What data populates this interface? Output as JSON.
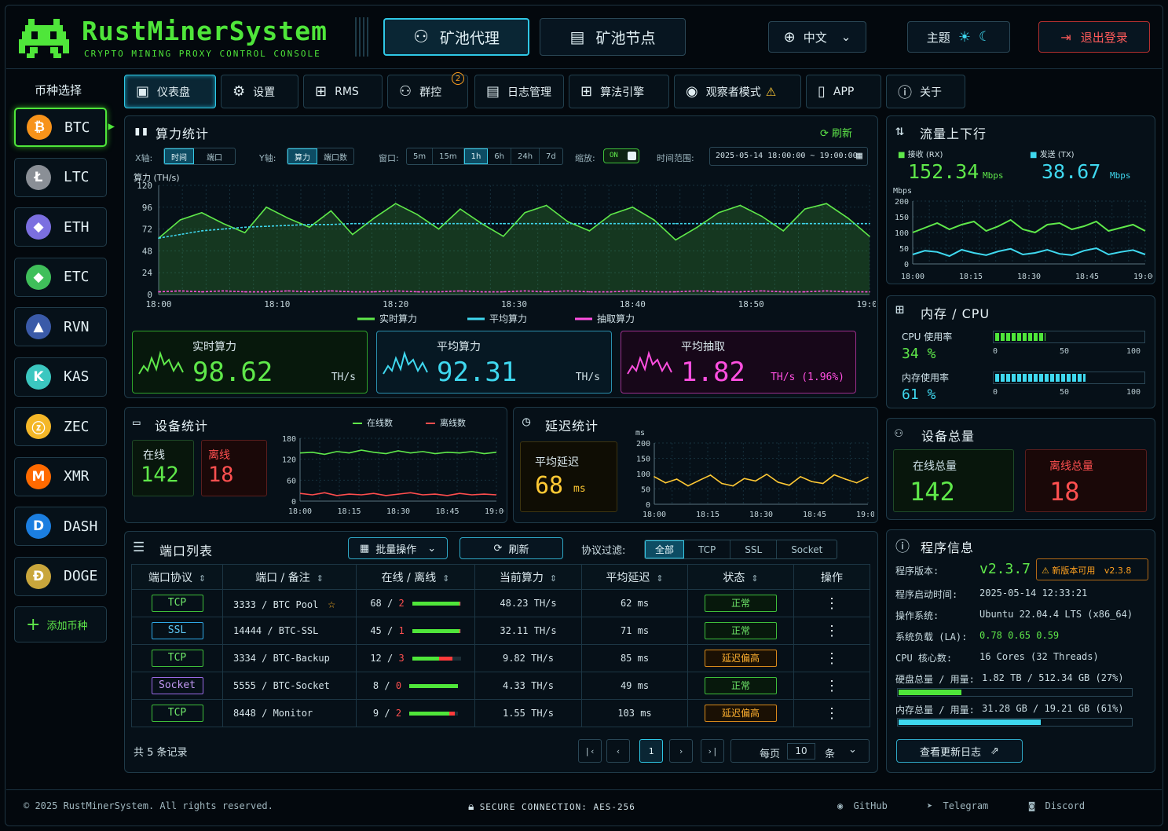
{
  "header": {
    "logo": "RustMinerSystem",
    "subtitle": "CRYPTO MINING PROXY CONTROL CONSOLE",
    "nav": [
      "矿池代理",
      "矿池节点"
    ],
    "lang": "中文",
    "theme": "主题",
    "logout": "退出登录"
  },
  "sidebar": {
    "title": "币种选择",
    "coins": [
      {
        "name": "BTC",
        "glyph": "₿",
        "color": "#f7931a"
      },
      {
        "name": "LTC",
        "glyph": "Ł",
        "color": "#8a8f96"
      },
      {
        "name": "ETH",
        "glyph": "◆",
        "color": "#7b6fe0"
      },
      {
        "name": "ETC",
        "glyph": "◆",
        "color": "#3fbf5a"
      },
      {
        "name": "RVN",
        "glyph": "▲",
        "color": "#3a5aa8"
      },
      {
        "name": "KAS",
        "glyph": "K",
        "color": "#3bc7c0"
      },
      {
        "name": "ZEC",
        "glyph": "ⓩ",
        "color": "#f4b728"
      },
      {
        "name": "XMR",
        "glyph": "M",
        "color": "#ff6a00"
      },
      {
        "name": "DASH",
        "glyph": "D",
        "color": "#1b7ee0"
      },
      {
        "name": "DOGE",
        "glyph": "Ð",
        "color": "#c9a63c"
      }
    ],
    "add": "添加币种"
  },
  "tabs": [
    {
      "label": "仪表盘"
    },
    {
      "label": "设置"
    },
    {
      "label": "RMS"
    },
    {
      "label": "群控",
      "badge": "2"
    },
    {
      "label": "日志管理"
    },
    {
      "label": "算法引擎"
    },
    {
      "label": "观察者模式"
    },
    {
      "label": "APP"
    },
    {
      "label": "关于"
    }
  ],
  "hashrate": {
    "title": "算力统计",
    "refresh": "刷新",
    "xaxis_label": "X轴:",
    "xaxis_opts": [
      "时间",
      "端口"
    ],
    "yaxis_label": "Y轴:",
    "yaxis_opts": [
      "算力",
      "端口数"
    ],
    "window_label": "窗口:",
    "windows": [
      "5m",
      "15m",
      "1h",
      "6h",
      "24h",
      "7d"
    ],
    "zoom_label": "缩放:",
    "zoom_state": "ON",
    "range_label": "时间范围:",
    "range_value": "2025-05-14 18:00:00 ~ 19:00:00",
    "unit_label": "算力 (TH/s)",
    "kpis": [
      {
        "title": "实时算力",
        "value": "98.62",
        "unit": "TH/s"
      },
      {
        "title": "平均算力",
        "value": "92.31",
        "unit": "TH/s"
      },
      {
        "title": "平均抽取",
        "value": "1.82",
        "unit": "TH/s (1.96%)"
      }
    ]
  },
  "chart_data": [
    {
      "type": "line",
      "title": "算力统计",
      "ylabel": "算力 (TH/s)",
      "ylim": [
        0,
        120
      ],
      "yticks": [
        0,
        24,
        48,
        72,
        96,
        120
      ],
      "x": [
        "18:00",
        "18:10",
        "18:20",
        "18:30",
        "18:40",
        "18:50",
        "19:00"
      ],
      "series": [
        {
          "name": "实时算力",
          "color": "#5fe84a",
          "values": [
            62,
            82,
            90,
            78,
            68,
            96,
            84,
            74,
            92,
            66,
            84,
            100,
            88,
            72,
            94,
            78,
            64,
            90,
            98,
            80,
            70,
            88,
            96,
            82,
            60,
            74,
            90,
            98,
            86,
            70,
            94,
            100,
            84,
            64
          ]
        },
        {
          "name": "平均算力",
          "color": "#3fd8ef",
          "values": [
            62,
            66,
            70,
            72,
            74,
            75,
            76,
            77,
            77,
            78,
            78,
            78,
            78,
            78,
            78,
            78,
            78,
            78,
            78,
            78,
            78,
            78,
            78,
            78,
            78,
            78,
            78,
            78,
            78,
            78,
            78,
            78,
            78,
            78
          ]
        },
        {
          "name": "抽取算力",
          "color": "#ff4fe0",
          "values": [
            3,
            4,
            3,
            4,
            3,
            3,
            4,
            3,
            4,
            3,
            3,
            4,
            3,
            3,
            4,
            3,
            3,
            4,
            3,
            4,
            3,
            3,
            4,
            3,
            3,
            4,
            3,
            3,
            4,
            3,
            3,
            4,
            3,
            3
          ]
        }
      ]
    },
    {
      "type": "line",
      "title": "流量上下行",
      "ylabel": "Mbps",
      "ylim": [
        0,
        200
      ],
      "yticks": [
        0,
        50,
        100,
        150,
        200
      ],
      "x": [
        "18:00",
        "18:15",
        "18:30",
        "18:45",
        "19:00"
      ],
      "series": [
        {
          "name": "接收 (RX)",
          "color": "#5fe84a",
          "values": [
            100,
            115,
            130,
            110,
            125,
            135,
            105,
            120,
            140,
            110,
            100,
            125,
            130,
            110,
            120,
            135,
            105,
            115,
            125,
            105
          ]
        },
        {
          "name": "发送 (TX)",
          "color": "#3fd8ef",
          "values": [
            30,
            42,
            38,
            25,
            45,
            35,
            28,
            40,
            48,
            30,
            35,
            45,
            32,
            28,
            42,
            50,
            30,
            38,
            44,
            30
          ]
        }
      ]
    },
    {
      "type": "line",
      "title": "设备统计",
      "ylim": [
        0,
        180
      ],
      "yticks": [
        0,
        60,
        120,
        180
      ],
      "x": [
        "18:00",
        "18:15",
        "18:30",
        "18:45",
        "19:00"
      ],
      "series": [
        {
          "name": "在线数",
          "color": "#5fe84a",
          "values": [
            138,
            140,
            134,
            142,
            138,
            146,
            140,
            136,
            144,
            138,
            142,
            136,
            140,
            138,
            142,
            136,
            140
          ]
        },
        {
          "name": "离线数",
          "color": "#ff4d4d",
          "values": [
            22,
            18,
            24,
            16,
            20,
            18,
            22,
            16,
            20,
            24,
            18,
            20,
            16,
            22,
            18,
            20,
            18
          ]
        }
      ]
    },
    {
      "type": "line",
      "title": "延迟统计",
      "ylabel": "ms",
      "ylim": [
        0,
        200
      ],
      "yticks": [
        0,
        50,
        100,
        150,
        200
      ],
      "x": [
        "18:00",
        "18:15",
        "18:30",
        "18:45",
        "19:00"
      ],
      "series": [
        {
          "name": "延迟",
          "color": "#ffc934",
          "values": [
            90,
            70,
            82,
            60,
            78,
            95,
            68,
            60,
            84,
            76,
            98,
            72,
            62,
            90,
            74,
            68,
            96,
            82,
            70,
            88
          ]
        }
      ]
    }
  ],
  "traffic": {
    "title": "流量上下行",
    "rx_label": "接收 (RX)",
    "rx_value": "152.34",
    "tx_label": "发送 (TX)",
    "tx_value": "38.67",
    "unit": "Mbps"
  },
  "resources": {
    "title": "内存 / CPU",
    "cpu_label": "CPU 使用率",
    "cpu_value": "34 %",
    "cpu_level": 34,
    "mem_label": "内存使用率",
    "mem_value": "61 %",
    "mem_level": 61,
    "scale": [
      "0",
      "50",
      "100"
    ]
  },
  "devices_total": {
    "title": "设备总量",
    "online_label": "在线总量",
    "online": "142",
    "offline_label": "离线总量",
    "offline": "18"
  },
  "devices": {
    "title": "设备统计",
    "online_label": "在线",
    "online": "142",
    "offline_label": "离线",
    "offline": "18",
    "legend_online": "在线数",
    "legend_offline": "离线数"
  },
  "latency": {
    "title": "延迟统计",
    "avg_label": "平均延迟",
    "avg_value": "68",
    "unit": "ms"
  },
  "ports": {
    "title": "端口列表",
    "batch": "批量操作",
    "refresh": "刷新",
    "filter_label": "协议过滤:",
    "filters": [
      "全部",
      "TCP",
      "SSL",
      "Socket"
    ],
    "headers": [
      "端口协议",
      "端口 / 备注",
      "在线 / 离线",
      "当前算力",
      "平均延迟",
      "状态",
      "操作"
    ],
    "rows": [
      {
        "proto": "TCP",
        "port": "3333 / BTC Pool",
        "star": true,
        "online": "68",
        "offline": "2",
        "online_frac": 0.97,
        "hash": "48.23 TH/s",
        "lat": "62 ms",
        "status": "正常"
      },
      {
        "proto": "SSL",
        "port": "14444 / BTC-SSL",
        "star": false,
        "online": "45",
        "offline": "1",
        "online_frac": 0.98,
        "hash": "32.11 TH/s",
        "lat": "71 ms",
        "status": "正常"
      },
      {
        "proto": "TCP",
        "port": "3334 / BTC-Backup",
        "star": false,
        "online": "12",
        "offline": "3",
        "online_frac": 0.55,
        "hash": "9.82 TH/s",
        "lat": "85 ms",
        "status": "延迟偏高"
      },
      {
        "proto": "Socket",
        "port": "5555 / BTC-Socket",
        "star": false,
        "online": "8",
        "offline": "0",
        "online_frac": 1.0,
        "hash": "4.33 TH/s",
        "lat": "49 ms",
        "status": "正常"
      },
      {
        "proto": "TCP",
        "port": "8448 / Monitor",
        "star": false,
        "online": "9",
        "offline": "2",
        "online_frac": 0.82,
        "hash": "1.55 TH/s",
        "lat": "103 ms",
        "status": "延迟偏高"
      }
    ],
    "total": "共 5 条记录",
    "page": "1",
    "per_page_label": "每页",
    "per_page": "10",
    "per_page_unit": "条"
  },
  "program": {
    "title": "程序信息",
    "version_label": "程序版本:",
    "version": "v2.3.7",
    "update_notice": "新版本可用",
    "update_version": "v2.3.8",
    "start_label": "程序启动时间:",
    "start": "2025-05-14 12:33:21",
    "os_label": "操作系统:",
    "os": "Ubuntu 22.04.4 LTS (x86_64)",
    "load_label": "系统负载 (LA):",
    "load": "0.78 0.65 0.59",
    "cores_label": "CPU 核心数:",
    "cores": "16 Cores (32 Threads)",
    "disk_label": "硬盘总量 / 用量:",
    "disk": "1.82 TB / 512.34 GB (27%)",
    "disk_level": 27,
    "mem_label": "内存总量 / 用量:",
    "mem": "31.28 GB / 19.21 GB (61%)",
    "mem_level": 61,
    "changelog": "查看更新日志"
  },
  "footer": {
    "copyright": "© 2025 RustMinerSystem. All rights reserved.",
    "secure": "SECURE CONNECTION: AES-256",
    "links": [
      "GitHub",
      "Telegram",
      "Discord"
    ]
  },
  "colors": {
    "green": "#5fe84a",
    "cyan": "#3fd8ef",
    "red": "#ff5050",
    "magenta": "#ff4fe0",
    "yellow": "#ffc934",
    "orange": "#ffa11f"
  }
}
